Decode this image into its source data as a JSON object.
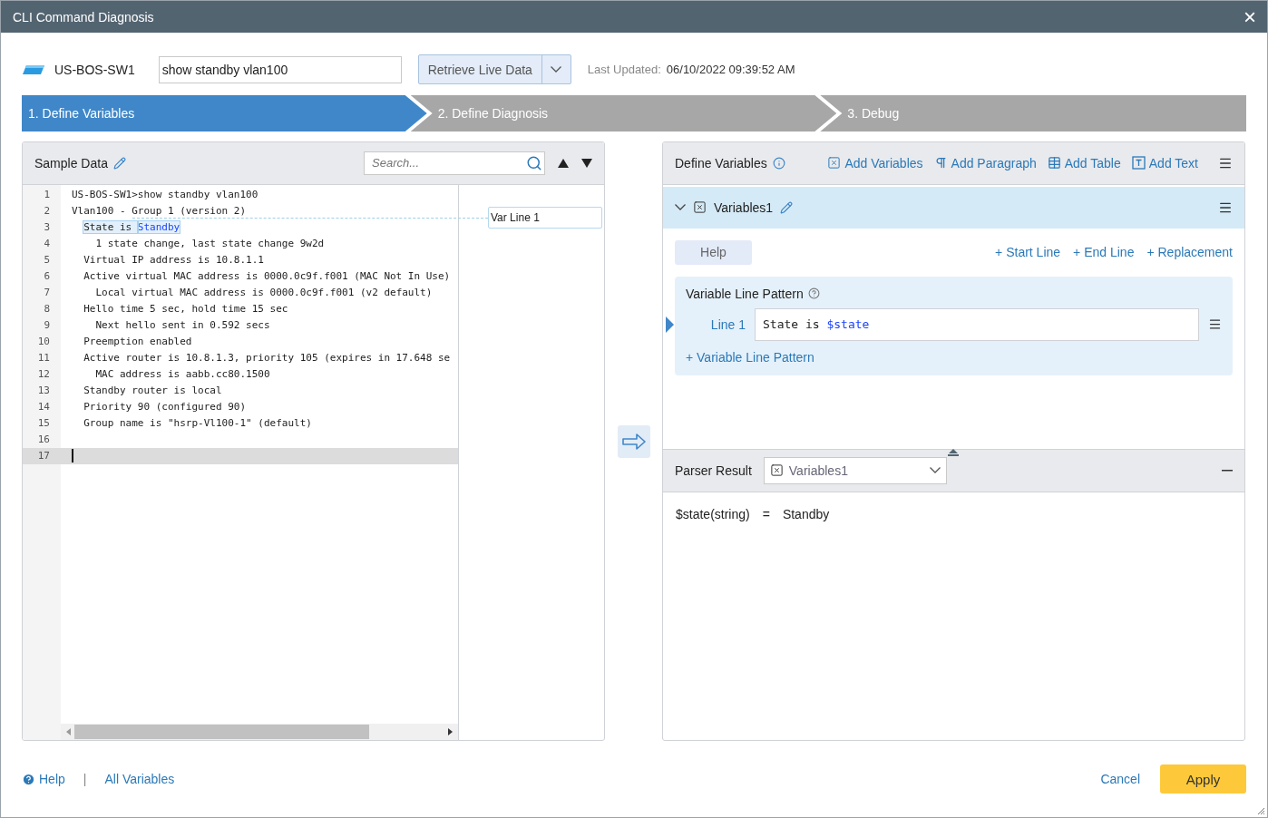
{
  "window": {
    "title": "CLI Command Diagnosis",
    "close": "×"
  },
  "toolbar": {
    "device": "US-BOS-SW1",
    "command": "show standby vlan100",
    "retrieve_button": "Retrieve Live Data",
    "last_updated_label": "Last Updated:",
    "last_updated_value": "06/10/2022 09:39:52 AM"
  },
  "steps": [
    {
      "label": "1. Define Variables",
      "selected": true
    },
    {
      "label": "2. Define Diagnosis",
      "selected": false
    },
    {
      "label": "3. Debug",
      "selected": false
    }
  ],
  "sample_data": {
    "title": "Sample Data",
    "search": {
      "placeholder": "Search..."
    },
    "lines": [
      {
        "number": "1",
        "parts": [
          {
            "text": "US-BOS-SW1>show standby vlan100",
            "kind": "plain"
          }
        ],
        "current": false
      },
      {
        "number": "2",
        "parts": [
          {
            "text": "Vlan100 - Group 1 (version 2)",
            "kind": "plain"
          }
        ],
        "current": false
      },
      {
        "number": "3",
        "parts": [
          {
            "text": "  State is ",
            "kind": "match"
          },
          {
            "text": "Standby",
            "kind": "match_variable"
          }
        ],
        "current": false,
        "tag": "Var Line 1"
      },
      {
        "number": "4",
        "parts": [
          {
            "text": "    1 state change, last state change 9w2d",
            "kind": "plain"
          }
        ],
        "current": false
      },
      {
        "number": "5",
        "parts": [
          {
            "text": "  Virtual IP address is 10.8.1.1",
            "kind": "plain"
          }
        ],
        "current": false
      },
      {
        "number": "6",
        "parts": [
          {
            "text": "  Active virtual MAC address is 0000.0c9f.f001 (MAC Not In Use)",
            "kind": "plain"
          }
        ],
        "current": false
      },
      {
        "number": "7",
        "parts": [
          {
            "text": "    Local virtual MAC address is 0000.0c9f.f001 (v2 default)",
            "kind": "plain"
          }
        ],
        "current": false
      },
      {
        "number": "8",
        "parts": [
          {
            "text": "  Hello time 5 sec, hold time 15 sec",
            "kind": "plain"
          }
        ],
        "current": false
      },
      {
        "number": "9",
        "parts": [
          {
            "text": "    Next hello sent in 0.592 secs",
            "kind": "plain"
          }
        ],
        "current": false
      },
      {
        "number": "10",
        "parts": [
          {
            "text": "  Preemption enabled",
            "kind": "plain"
          }
        ],
        "current": false
      },
      {
        "number": "11",
        "parts": [
          {
            "text": "  Active router is 10.8.1.3, priority 105 (expires in 17.648 se",
            "kind": "plain"
          }
        ],
        "current": false
      },
      {
        "number": "12",
        "parts": [
          {
            "text": "    MAC address is aabb.cc80.1500",
            "kind": "plain"
          }
        ],
        "current": false
      },
      {
        "number": "13",
        "parts": [
          {
            "text": "  Standby router is local",
            "kind": "plain"
          }
        ],
        "current": false
      },
      {
        "number": "14",
        "parts": [
          {
            "text": "  Priority 90 (configured 90)",
            "kind": "plain"
          }
        ],
        "current": false
      },
      {
        "number": "15",
        "parts": [
          {
            "text": "  Group name is \"hsrp-Vl100-1\" (default)",
            "kind": "plain"
          }
        ],
        "current": false
      },
      {
        "number": "16",
        "current": false
      },
      {
        "number": "17",
        "current": true
      }
    ]
  },
  "define_variables": {
    "title": "Define Variables",
    "actions": [
      "Add Variables",
      "Add Paragraph",
      "Add Table",
      "Add Text"
    ],
    "variable": {
      "name": "Variables1",
      "expanded": true,
      "help_button": "Help",
      "links": [
        "+ Start Line",
        "+ End Line",
        "+ Replacement"
      ],
      "pattern": {
        "title": "Variable Line Pattern",
        "lines": [
          {
            "label": "Line 1",
            "selected": true,
            "parts": [
              {
                "text": "State is ",
                "kind": "plain"
              },
              {
                "text": "$state",
                "kind": "variable"
              }
            ]
          }
        ],
        "add_link": "+ Variable Line Pattern"
      }
    }
  },
  "parser_result": {
    "title": "Parser Result",
    "selected_variable": "Variables1",
    "results": [
      {
        "name": "$state(string)",
        "equals": "=",
        "value": "Standby"
      }
    ]
  },
  "footer": {
    "help": "Help",
    "separator": "|",
    "all_variables": "All Variables",
    "cancel": "Cancel",
    "apply": "Apply"
  }
}
